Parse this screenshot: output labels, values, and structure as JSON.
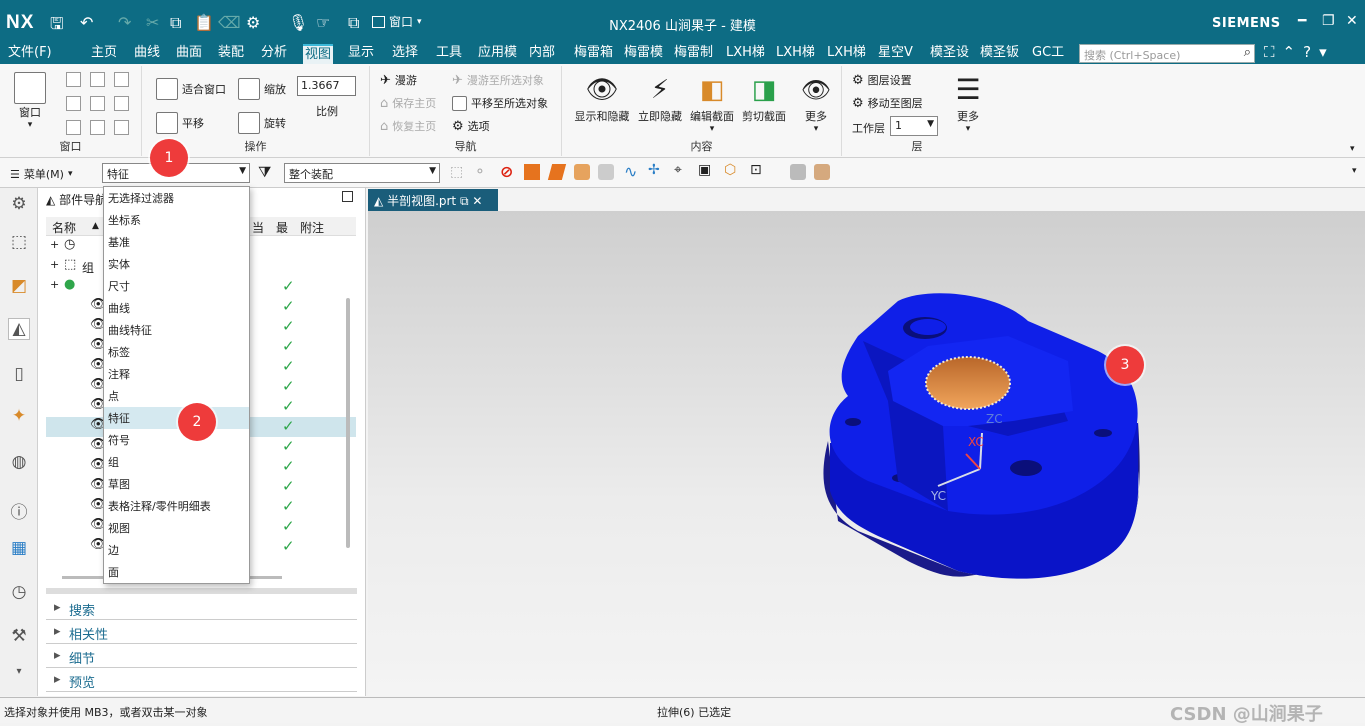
{
  "app": {
    "logo": "NX",
    "title": "NX2406 山涧果子 - 建模",
    "brand": "SIEMENS",
    "window_menu": "窗口"
  },
  "menubar": {
    "items": [
      "文件(F)",
      "主页",
      "曲线",
      "曲面",
      "装配",
      "分析",
      "视图",
      "显示",
      "选择",
      "工具",
      "应用模",
      "内部",
      "梅雷箱",
      "梅雷模",
      "梅雷制",
      "LXH梯",
      "LXH梯",
      "LXH梯",
      "星空V",
      "模圣设",
      "模圣钣",
      "GC工"
    ],
    "active": "视图",
    "search_placeholder": "搜索 (Ctrl+Space)"
  },
  "ribbon": {
    "window_group": {
      "label": "窗口",
      "button": "窗口"
    },
    "operate_group": {
      "label": "操作",
      "fit": "适合窗口",
      "zoom": "缩放",
      "zoom_value": "1.3667",
      "scale": "比例",
      "pan": "平移",
      "rotate": "旋转"
    },
    "nav_group": {
      "label": "导航",
      "roam": "漫游",
      "roam_sel": "漫游至所选对象",
      "save_home": "保存主页",
      "pan_sel": "平移至所选对象",
      "restore_home": "恢复主页",
      "options": "选项"
    },
    "content_group": {
      "label": "内容",
      "show_hide": "显示和隐藏",
      "hide_now": "立即隐藏",
      "edit_section": "编辑截面",
      "clip_section": "剪切截面",
      "more": "更多"
    },
    "layer_group": {
      "label": "层",
      "layer_settings": "图层设置",
      "move_layer": "移动至图层",
      "work_layer": "工作层",
      "work_layer_value": "1",
      "more": "更多"
    }
  },
  "toolbar2": {
    "menu": "菜单(M)",
    "filter_value": "特征",
    "assembly_value": "整个装配"
  },
  "navigator": {
    "title": "部件导航器",
    "columns": [
      "名称",
      "当",
      "最",
      "附注"
    ],
    "row_labels": {
      "r1": "组"
    },
    "sections": [
      "搜索",
      "相关性",
      "细节",
      "预览"
    ]
  },
  "dropdown": {
    "items": [
      "无选择过滤器",
      "坐标系",
      "基准",
      "实体",
      "尺寸",
      "曲线",
      "曲线特征",
      "标签",
      "注释",
      "点",
      "特征",
      "符号",
      "组",
      "草图",
      "表格注释/零件明细表",
      "视图",
      "边",
      "面"
    ],
    "highlighted": "特征"
  },
  "tab": {
    "label": "半剖视图.prt"
  },
  "viewport": {
    "axis_zc": "ZC",
    "axis_xc": "XC",
    "axis_yc": "YC"
  },
  "status": {
    "left": "选择对象并使用 MB3，或者双击某一对象",
    "center": "拉伸(6) 已选定",
    "watermark": "CSDN @山涧果子"
  },
  "callouts": [
    "1",
    "2",
    "3"
  ],
  "colors": {
    "titlebar": "#0d6c84",
    "part_blue": "#0f1fe8",
    "bore": "#e8913a",
    "callout": "#ee3b3b",
    "check": "#2fa64b"
  }
}
